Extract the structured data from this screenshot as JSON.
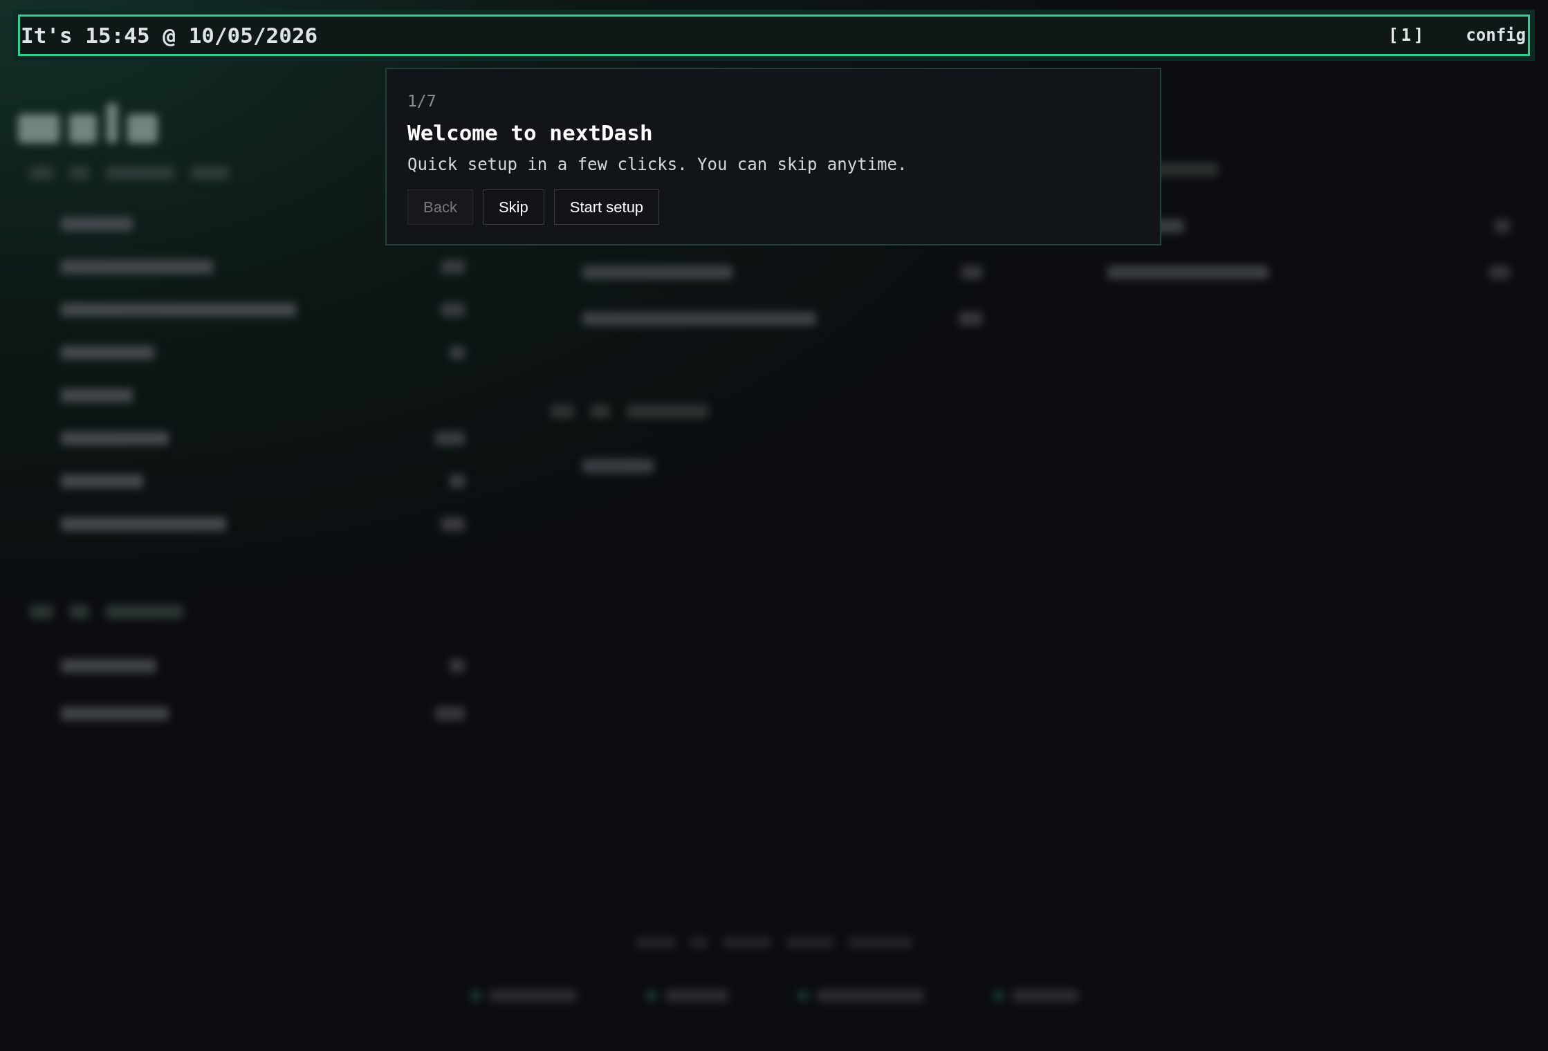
{
  "top_bar": {
    "datetime": "It's 15:45 @ 10/05/2026",
    "workspace": "[1]",
    "config": "config"
  },
  "dialog": {
    "step": "1/7",
    "title": "Welcome to nextDash",
    "message": "Quick setup in a few clicks. You can skip anytime.",
    "buttons": [
      {
        "label": "Back",
        "disabled": true
      },
      {
        "label": "Skip",
        "disabled": false
      },
      {
        "label": "Start setup",
        "disabled": false
      }
    ]
  }
}
